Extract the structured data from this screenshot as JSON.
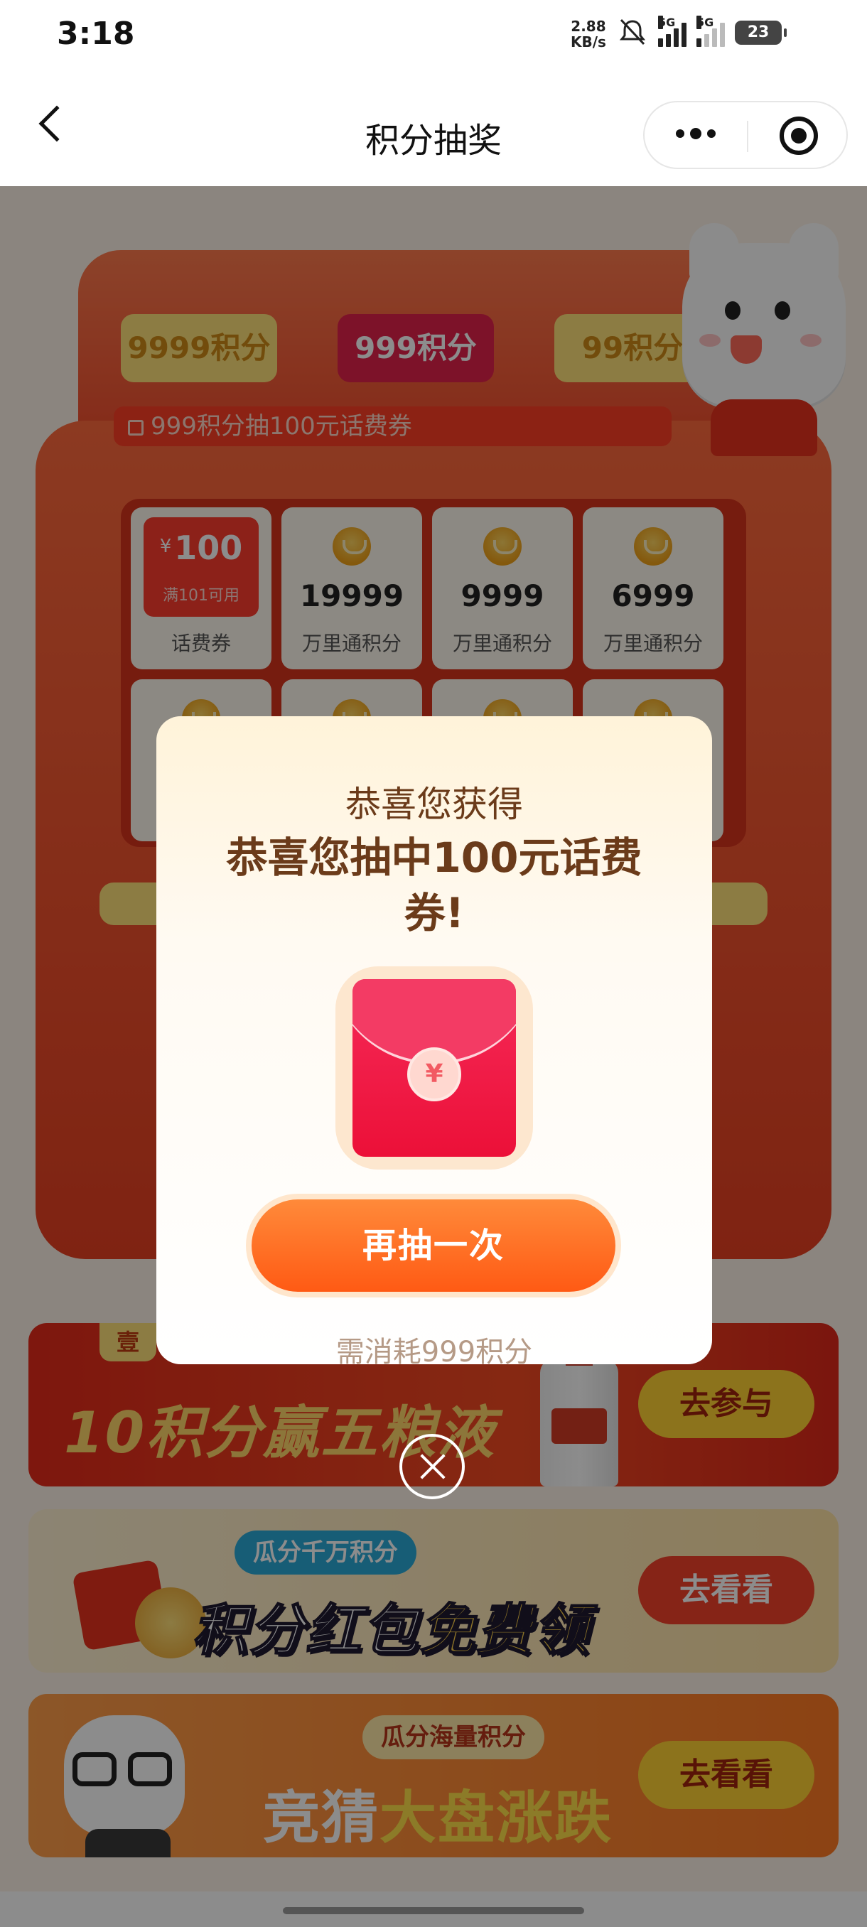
{
  "status_bar": {
    "time": "3:18",
    "net_speed_value": "2.88",
    "net_speed_unit": "KB/s",
    "sim1": "5G",
    "sim2": "5G",
    "battery": "23"
  },
  "nav": {
    "title": "积分抽奖",
    "icons": [
      "back-icon",
      "more-icon",
      "target-icon"
    ]
  },
  "draw": {
    "tabs": [
      "9999积分",
      "999积分",
      "99积分"
    ],
    "active_tab": "999积分",
    "notice": "999积分抽100元话费券",
    "prizes": [
      {
        "coupon_currency": "¥",
        "coupon_amount": "100",
        "coupon_condition": "满101可用",
        "label": "话费券"
      },
      {
        "value": "19999",
        "label": "万里通积分"
      },
      {
        "value": "9999",
        "label": "万里通积分"
      },
      {
        "value": "6999",
        "label": "万里通积分"
      }
    ]
  },
  "banners": [
    {
      "tag": "壹",
      "headline": "10积分赢五粮液",
      "cta": "去参与"
    },
    {
      "chip": "瓜分千万积分",
      "headline_a": "积分红包",
      "headline_b": "免费领",
      "cta": "去看看"
    },
    {
      "chip": "瓜分海量积分",
      "headline_a": "竞猜",
      "headline_b": "大盘涨跌",
      "cta": "去看看"
    }
  ],
  "modal": {
    "subtitle": "恭喜您获得",
    "headline": "恭喜您抽中100元话费券!",
    "envelope_symbol": "¥",
    "button": "再抽一次",
    "cost": "需消耗999积分"
  },
  "colors": {
    "accent": "#ff5a14",
    "machine_red": "#e84022",
    "modal_text": "#6b3b1a"
  }
}
